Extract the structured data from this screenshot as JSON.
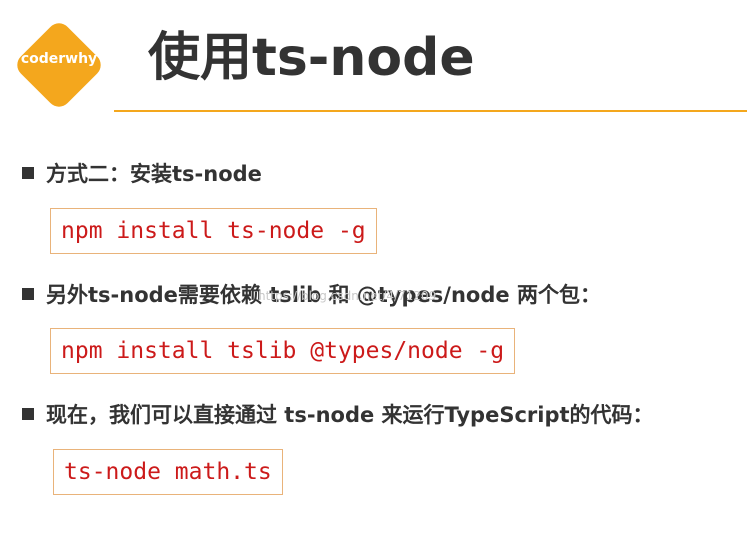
{
  "logo": {
    "text": "coderwhy"
  },
  "title": "使用ts-node",
  "bullets": [
    {
      "text": "方式二：安装ts-node"
    },
    {
      "text": "另外ts-node需要依赖 tslib 和 @types/node 两个包："
    },
    {
      "text": "现在，我们可以直接通过 ts-node 来运行TypeScript的代码："
    }
  ],
  "code": [
    "npm install ts-node -g",
    "npm install tslib @types/node -g",
    "ts-node math.ts"
  ],
  "watermark": "https://blog.csdn.net/4/71209",
  "colors": {
    "accent": "#f4a71d",
    "code_text": "#cc1a1a",
    "code_border": "#e9b37a",
    "text": "#333333"
  }
}
